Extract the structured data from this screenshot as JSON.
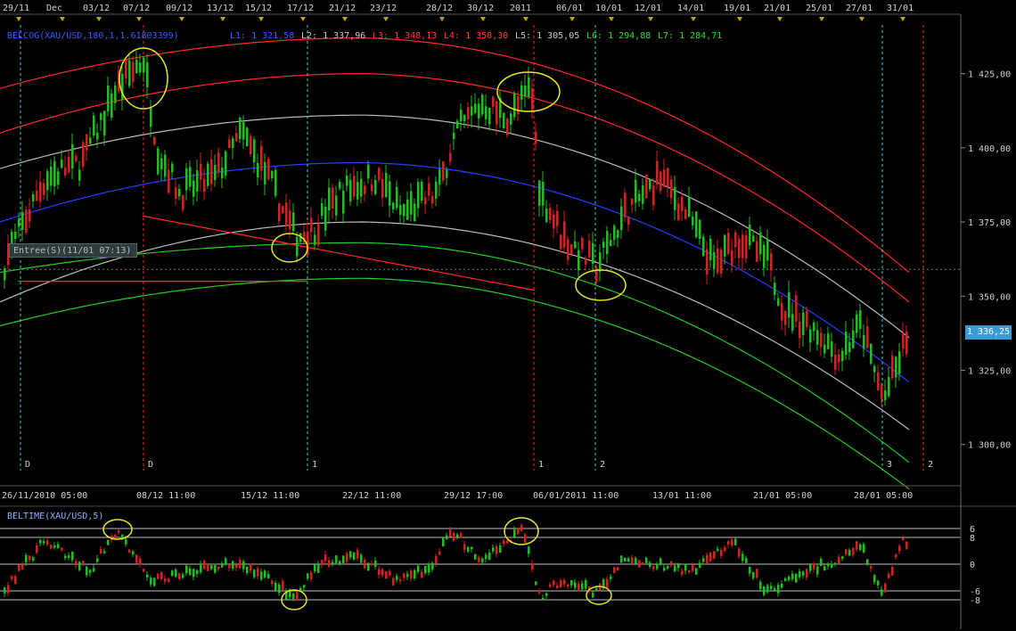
{
  "chart_data": [
    {
      "type": "candlestick",
      "instrument": "XAU/USD",
      "top_dates": [
        "29/11",
        "Dec",
        "03/12",
        "07/12",
        "09/12",
        "13/12",
        "15/12",
        "17/12",
        "21/12",
        "23/12",
        "28/12",
        "30/12",
        "2011",
        "06/01",
        "10/01",
        "12/01",
        "14/01",
        "19/01",
        "21/01",
        "25/01",
        "27/01",
        "31/01"
      ],
      "bottom_dates": [
        "26/11/2010 05:00",
        "08/12 11:00",
        "15/12 11:00",
        "22/12 11:00",
        "29/12 17:00",
        "06/01/2011 11:00",
        "13/01 11:00",
        "21/01 05:00",
        "28/01 05:00"
      ],
      "y_ticks": [
        "1 425,00",
        "1 400,00",
        "1 375,00",
        "1 350,00",
        "1 325,00",
        "1 300,00"
      ],
      "ylim": [
        1290,
        1445
      ],
      "legend": {
        "indicator": "BELCOG(XAU/USD,180,1,1.61803399)",
        "levels": [
          {
            "label": "L1: 1 321,58",
            "color": "#3a5cff"
          },
          {
            "label": "L2: 1 337,96",
            "color": "#c8c8c8"
          },
          {
            "label": "L3: 1 348,13",
            "color": "#ff3b3b"
          },
          {
            "label": "L4: 1 358,30",
            "color": "#ff3b3b"
          },
          {
            "label": "L5: 1 305,05",
            "color": "#c8c8c8"
          },
          {
            "label": "L6: 1 294,88",
            "color": "#33dd33"
          },
          {
            "label": "L7: 1 284,71",
            "color": "#33dd33"
          }
        ]
      },
      "last_price": "1 336,25",
      "entry_label": "Entree(S)(11/01 07:13)",
      "cycle_markers": [
        "D",
        "D",
        "1",
        "1",
        "2",
        "3",
        "2"
      ],
      "colors": {
        "up": "#22bb22",
        "down": "#d42020",
        "blue": "#2a3cff",
        "red": "#ff2a2a",
        "white": "#bcbcbc",
        "green": "#22cc22",
        "cyan": "#3ad6c8"
      }
    },
    {
      "type": "oscillator",
      "indicator": "BELTIME(XAU/USD,5)",
      "levels": [
        "6",
        "8",
        "0",
        "-6",
        "-8"
      ]
    }
  ]
}
